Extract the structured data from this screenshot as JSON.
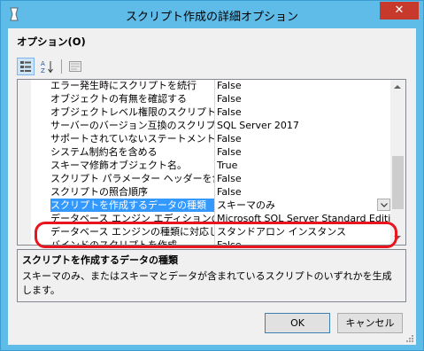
{
  "window": {
    "title": "スクリプト作成の詳細オプション",
    "close_glyph": "✕"
  },
  "options_label": "オプション(O)",
  "properties": [
    {
      "name": "エラー発生時にスクリプトを続行",
      "value": "False"
    },
    {
      "name": "オブジェクトの有無を確認する",
      "value": "False"
    },
    {
      "name": "オブジェクトレベル権限のスクリプトを作成",
      "value": "False"
    },
    {
      "name": "サーバーのバージョン互換のスクリプト",
      "value": "SQL Server 2017"
    },
    {
      "name": "サポートされていないステートメントを含める",
      "value": "False"
    },
    {
      "name": "システム制約名を含める",
      "value": "False"
    },
    {
      "name": "スキーマ修飾オブジェクト名。",
      "value": "True"
    },
    {
      "name": "スクリプト パラメーター ヘッダーを含める",
      "value": "False"
    },
    {
      "name": "スクリプトの照合順序",
      "value": "False"
    },
    {
      "name": "スクリプトを作成するデータの種類",
      "value": "スキーマのみ",
      "selected": true
    },
    {
      "name": "データベース エンジン エディションのスクリプト",
      "value": "Microsoft SQL Server Standard Edition"
    },
    {
      "name": "データベース エンジンの種類に対応したスクリプト",
      "value": "スタンドアロン インスタンス"
    },
    {
      "name": "バインドのスクリプトを作成",
      "value": "False"
    }
  ],
  "description": {
    "title": "スクリプトを作成するデータの種類",
    "text": "スキーマのみ、またはスキーマとデータが含まれているスクリプトのいずれかを生成します。"
  },
  "buttons": {
    "ok": "OK",
    "cancel": "キャンセル"
  },
  "colors": {
    "title_bar": "#5fbbe8",
    "close_button": "#c7392b",
    "selection": "#3399ff",
    "highlight_annotation": "#e8141e"
  }
}
